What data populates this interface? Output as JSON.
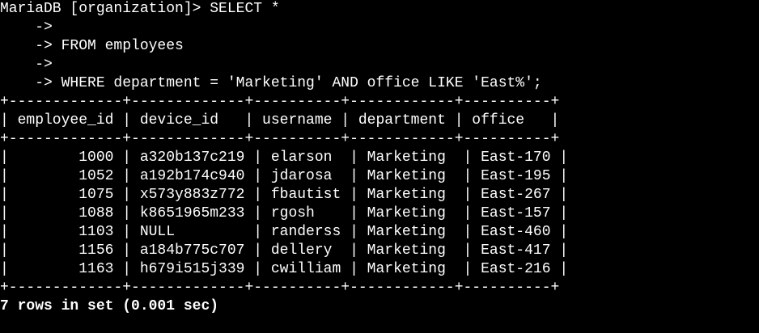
{
  "terminal": {
    "prompt_line": "MariaDB [organization]> SELECT *",
    "cont_lines": [
      "    ->",
      "    -> FROM employees",
      "    ->",
      "    -> WHERE department = 'Marketing' AND office LIKE 'East%';"
    ],
    "table": {
      "separator": "+-------------+-------------+----------+------------+----------+",
      "header": "| employee_id | device_id   | username | department | office   |",
      "rows": [
        "|        1000 | a320b137c219 | elarson  | Marketing  | East-170 |",
        "|        1052 | a192b174c940 | jdarosa  | Marketing  | East-195 |",
        "|        1075 | x573y883z772 | fbautist | Marketing  | East-267 |",
        "|        1088 | k8651965m233 | rgosh    | Marketing  | East-157 |",
        "|        1103 | NULL         | randerss | Marketing  | East-460 |",
        "|        1156 | a184b775c707 | dellery  | Marketing  | East-417 |",
        "|        1163 | h679i515j339 | cwilliam | Marketing  | East-216 |"
      ]
    },
    "footer": "7 rows in set (0.001 sec)"
  },
  "colors": {
    "background": "#000000",
    "text": "#ffffff"
  }
}
